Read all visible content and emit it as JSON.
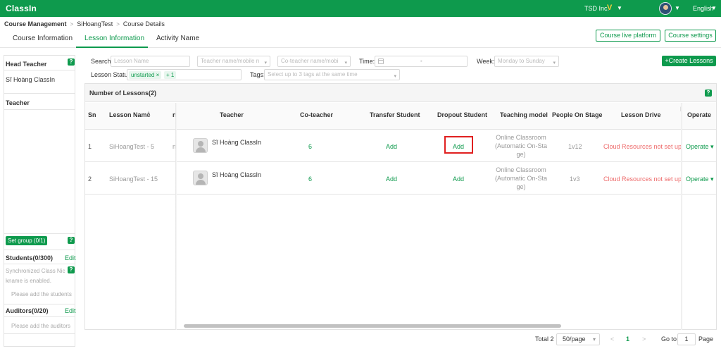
{
  "topbar": {
    "logo": "ClassIn",
    "org_name": "TSD Inc.",
    "org_badge": "V",
    "caret": "▼",
    "language": "English"
  },
  "breadcrumb": [
    "Course Management",
    "SiHoangTest",
    "Course Details"
  ],
  "breadcrumb_sep": ">",
  "tabs": [
    "Course Information",
    "Lesson Information",
    "Activity Name"
  ],
  "header_buttons": {
    "live": "Course live platform",
    "settings": "Course settings"
  },
  "left_panel": {
    "head_teacher_title": "Head Teacher",
    "head_teacher_name": "Sĩ Hoàng ClassIn",
    "teacher_title": "Teacher",
    "set_group": "Set group (0/1)",
    "students_title": "Students(0/300)",
    "edit": "Edit",
    "sync_line1": "Synchronized Class Nic",
    "sync_line2": "kname is enabled.",
    "add_students": "Please add the students",
    "auditors_title": "Auditors(0/20)",
    "add_auditors": "Please add the auditors",
    "help": "?"
  },
  "filters": {
    "search_label": "Search:",
    "lesson_name_ph": "Lesson Name",
    "teacher_ph": "Teacher name/mobile n",
    "coteacher_ph": "Co-teacher name/mobi",
    "time_label": "Time:",
    "time_sep": "-",
    "week_label": "Week:",
    "week_ph": "Monday to Sunday",
    "status_label": "Lesson Status:",
    "status_chip": "unstarted",
    "chip_close": "×",
    "status_more": "+ 1",
    "tags_label": "Tags:",
    "tags_ph": "Select up to 3 tags at the same time",
    "create_btn": "Create Lessons",
    "plus": "+"
  },
  "table": {
    "title": "Number of Lessons(2)",
    "help": "?",
    "columns": {
      "sn": "Sn",
      "lesson_name": "Lesson Name",
      "partial": "n",
      "teacher": "Teacher",
      "coteacher": "Co-teacher",
      "transfer": "Transfer Student",
      "dropout": "Dropout Student",
      "teaching_model": "Teaching model",
      "people": "People On Stage",
      "drive": "Lesson Drive",
      "partial_right": "I",
      "operate": "Operate"
    },
    "sort_icons": [
      "▲",
      "▼"
    ],
    "rows": [
      {
        "sn": "1",
        "lesson_name": "SiHoangTest - 5",
        "partial": "n",
        "teacher": "Sĩ Hoàng ClassIn",
        "coteacher": "6",
        "transfer": "Add",
        "dropout": "Add",
        "tm1": "Online Classroom",
        "tm2": "(Automatic On-Sta",
        "tm3": "ge)",
        "people": "1v12",
        "drive": "Cloud Resources not set up",
        "operate": "Operate ▾"
      },
      {
        "sn": "2",
        "lesson_name": "SiHoangTest - 15",
        "partial": "",
        "teacher": "Sĩ Hoàng ClassIn",
        "coteacher": "6",
        "transfer": "Add",
        "dropout": "Add",
        "tm1": "Online Classroom",
        "tm2": "(Automatic On-Sta",
        "tm3": "ge)",
        "people": "1v3",
        "drive": "Cloud Resources not set up",
        "operate": "Operate ▾"
      }
    ]
  },
  "pagination": {
    "total": "Total 2",
    "page_size": "50/page",
    "prev": "<",
    "current": "1",
    "next": ">",
    "goto": "Go to",
    "goto_value": "1",
    "page_word": "Page",
    "caret": "▾"
  },
  "colors": {
    "brand": "#0e9a4d",
    "danger_text": "#ee6a6a",
    "highlight": "#e02020",
    "badge": "#f4d03f"
  }
}
